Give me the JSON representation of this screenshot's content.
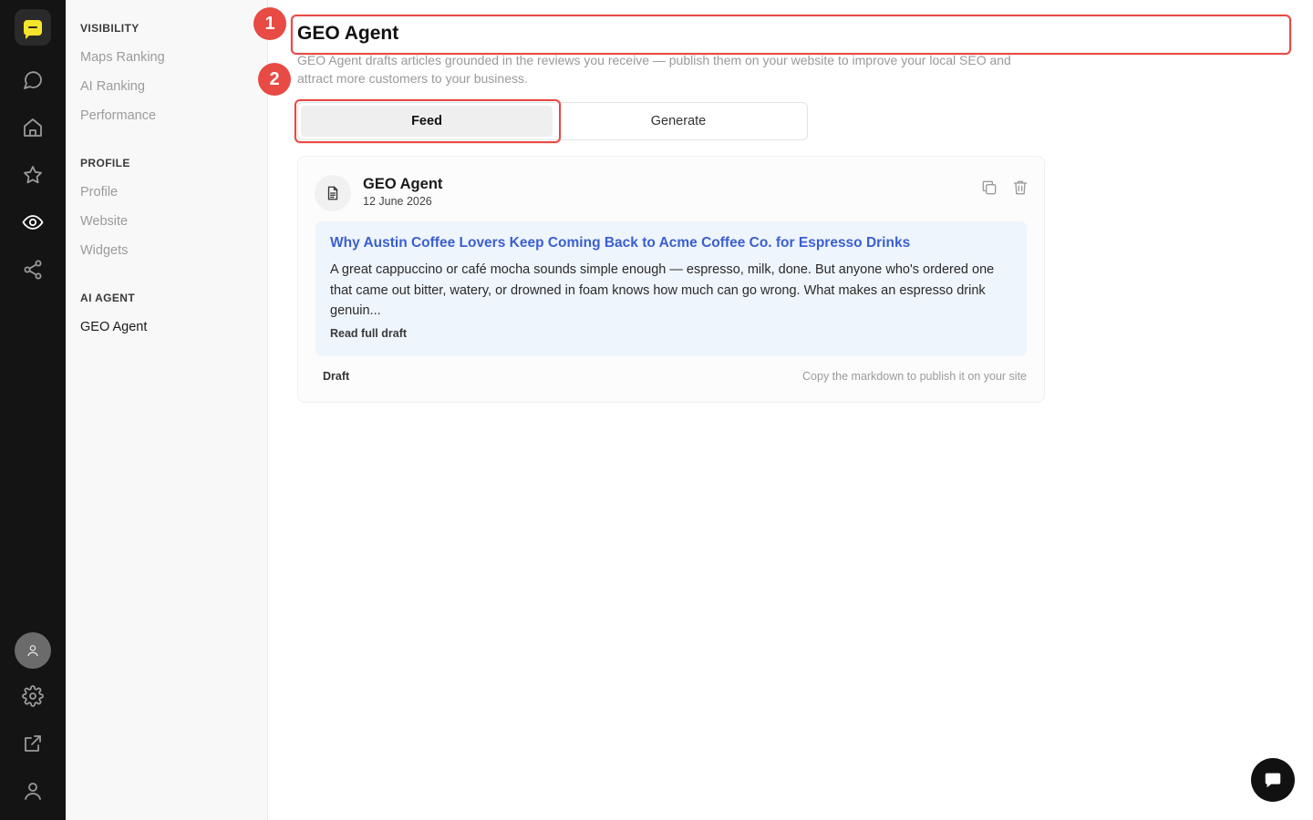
{
  "rail": {
    "logo": "chat-bubble-logo",
    "icons": [
      "messages-icon",
      "home-icon",
      "star-icon",
      "eye-icon",
      "share-icon",
      "settings-icon",
      "external-link-icon",
      "user-icon"
    ],
    "active": "eye-icon"
  },
  "subnav": {
    "sections": [
      {
        "title": "VISIBILITY",
        "items": [
          "Maps Ranking",
          "AI Ranking",
          "Performance"
        ]
      },
      {
        "title": "PROFILE",
        "items": [
          "Profile",
          "Website",
          "Widgets"
        ]
      },
      {
        "title": "AI AGENT",
        "items": [
          "GEO Agent"
        ]
      }
    ],
    "active_item": "GEO Agent"
  },
  "page": {
    "title": "GEO Agent",
    "description": "GEO Agent drafts articles grounded in the reviews you receive — publish them on your website to improve your local SEO and attract more customers to your business."
  },
  "tabs": [
    {
      "label": "Feed",
      "active": true
    },
    {
      "label": "Generate",
      "active": false
    }
  ],
  "card": {
    "title": "GEO Agent",
    "date": "12 June 2026",
    "draft_title": "Why Austin Coffee Lovers Keep Coming Back to Acme Coffee Co. for Espresso Drinks",
    "draft_excerpt": "A great cappuccino or café mocha sounds simple enough — espresso, milk, done. But anyone who's ordered one that came out bitter, watery, or drowned in foam knows how much can go wrong. What makes an espresso drink genuin...",
    "read_more": "Read full draft",
    "status": "Draft",
    "hint": "Copy the markdown to publish it on your site"
  },
  "annotations": [
    "1",
    "2"
  ],
  "colors": {
    "accent_link": "#3a5fd0",
    "annotation": "#e84a44",
    "brand": "#f5e52a",
    "rail_bg": "#141414"
  }
}
